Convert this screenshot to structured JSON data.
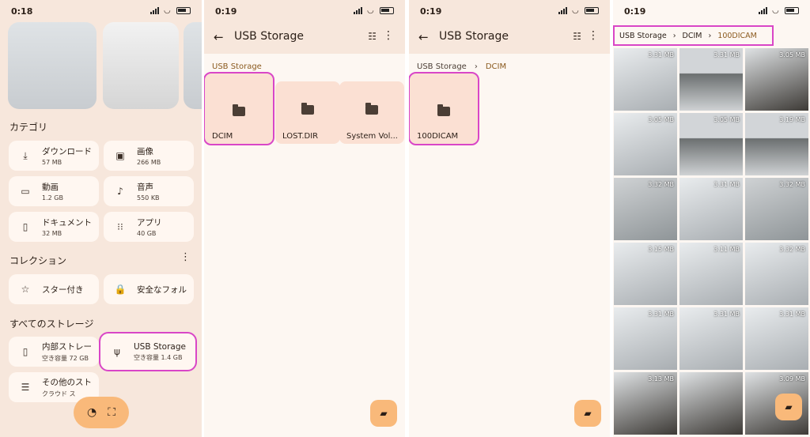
{
  "screen1": {
    "time": "0:18",
    "category_title": "カテゴリ",
    "categories": [
      {
        "icon": "download-icon",
        "glyph": "⤓",
        "label": "ダウンロード",
        "size": "57 MB"
      },
      {
        "icon": "image-icon",
        "glyph": "▣",
        "label": "画像",
        "size": "266 MB"
      },
      {
        "icon": "video-icon",
        "glyph": "▭",
        "label": "動画",
        "size": "1.2 GB"
      },
      {
        "icon": "music-icon",
        "glyph": "♪",
        "label": "音声",
        "size": "550 KB"
      },
      {
        "icon": "document-icon",
        "glyph": "▯",
        "label": "ドキュメント",
        "size": "32 MB"
      },
      {
        "icon": "apps-icon",
        "glyph": "⁝⁝",
        "label": "アプリ",
        "size": "40 GB"
      }
    ],
    "collection_title": "コレクション",
    "collections": [
      {
        "glyph": "☆",
        "label": "スター付き"
      },
      {
        "glyph": "🔒",
        "label": "安全なフォル"
      }
    ],
    "storage_title": "すべてのストレージ",
    "storages": [
      {
        "glyph": "▯",
        "label": "内部ストレー",
        "sub": "空き容量 72 GB"
      },
      {
        "glyph": "ψ",
        "label": "USB Storage",
        "sub": "空き容量 1.4 GB"
      },
      {
        "glyph": "☰",
        "label": "その他のスト",
        "sub": "クラウド ス"
      }
    ]
  },
  "screen2": {
    "time": "0:19",
    "title": "USB Storage",
    "crumb": "USB Storage",
    "folders": [
      "DCIM",
      "LOST.DIR",
      "System Vol..."
    ]
  },
  "screen3": {
    "time": "0:19",
    "title": "USB Storage",
    "crumbs": [
      "USB Storage",
      "DCIM"
    ],
    "folders": [
      "100DICAM"
    ]
  },
  "screen4": {
    "time": "0:19",
    "crumbs": [
      "USB Storage",
      "DCIM",
      "100DICAM"
    ],
    "photos": [
      "3.31 MB",
      "3.31 MB",
      "3.05 MB",
      "3.05 MB",
      "3.05 MB",
      "3.19 MB",
      "3.32 MB",
      "3.31 MB",
      "3.32 MB",
      "3.15 MB",
      "3.11 MB",
      "3.32 MB",
      "3.31 MB",
      "3.31 MB",
      "3.31 MB",
      "3.13 MB",
      "",
      "3.09 MB"
    ]
  }
}
